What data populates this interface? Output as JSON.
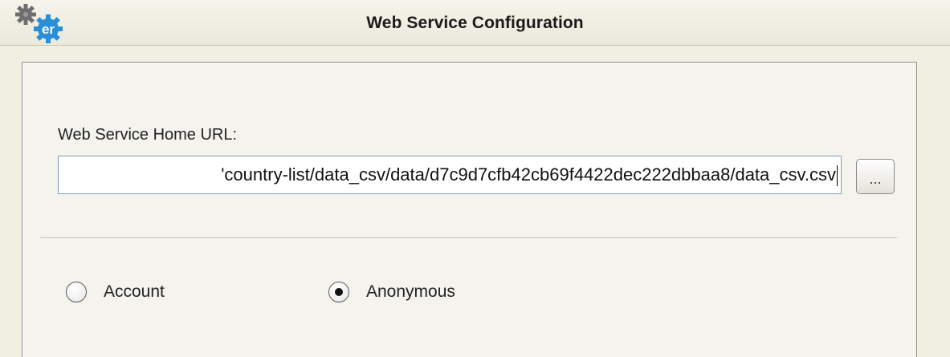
{
  "window": {
    "title": "Web Service Configuration",
    "app_icon": "gear-er-logo-icon"
  },
  "form": {
    "url_label": "Web Service Home URL:",
    "url_value": "'country-list/data_csv/data/d7c9d7cfb42cb69f4422dec222dbbaa8/data_csv.csv",
    "browse_label": "...",
    "auth_options": [
      {
        "label": "Account",
        "selected": false
      },
      {
        "label": "Anonymous",
        "selected": true
      }
    ]
  }
}
